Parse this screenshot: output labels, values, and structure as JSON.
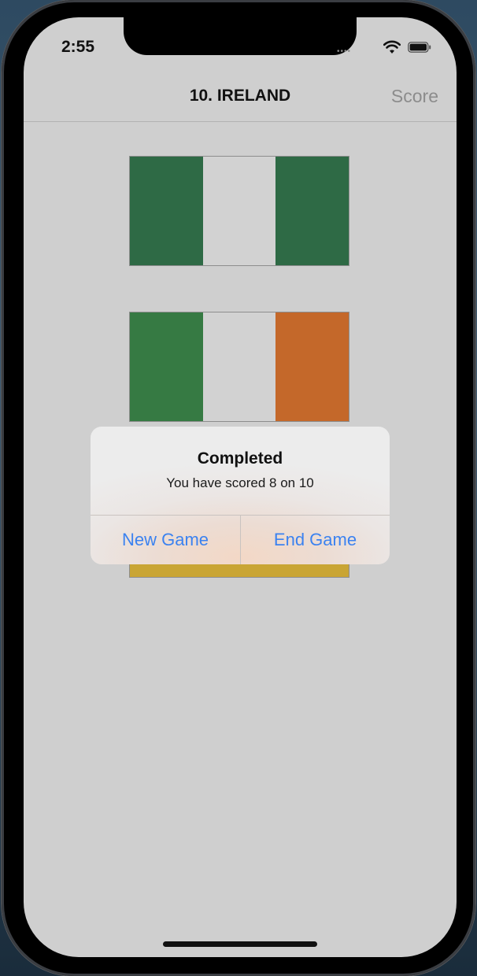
{
  "status_bar": {
    "time": "2:55",
    "signal_icon": "cellular-dots-icon",
    "wifi_icon": "wifi-icon",
    "battery_icon": "battery-icon"
  },
  "nav": {
    "title": "10. IRELAND",
    "score_label": "Score"
  },
  "flags": [
    {
      "stripes": [
        "#2e6a45",
        "#d2d2d2",
        "#2e6a45"
      ]
    },
    {
      "stripes": [
        "#367a43",
        "#d2d2d2",
        "#c4682a"
      ]
    },
    {
      "stripes": [
        "#c9a534",
        "#c9a534",
        "#c9a534"
      ]
    }
  ],
  "alert": {
    "title": "Completed",
    "message": "You have scored 8 on 10",
    "primary_label": "New Game",
    "secondary_label": "End Game"
  },
  "colors": {
    "accent": "#3b82f0",
    "screen_background": "#cfcfcf"
  }
}
